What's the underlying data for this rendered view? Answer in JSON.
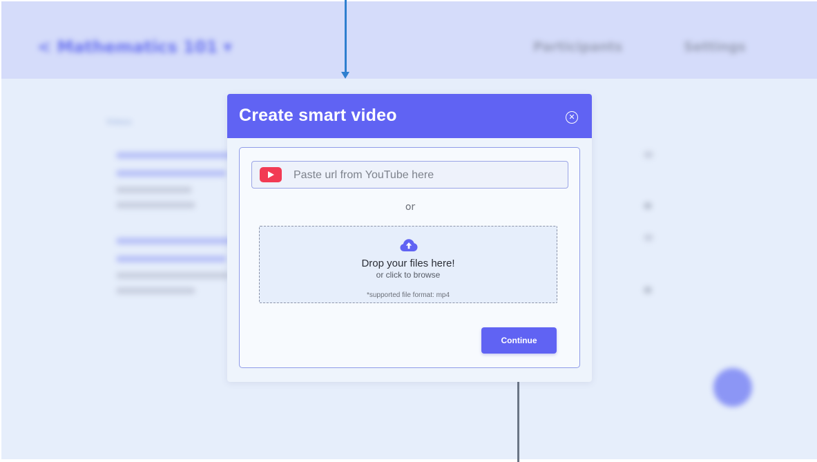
{
  "background": {
    "course_title": "< Mathematics 101 ▾",
    "nav": [
      "Participants",
      "Settings"
    ],
    "section_label": "Videos"
  },
  "modal": {
    "title": "Create smart video",
    "close_icon": "close-circle-icon",
    "url_placeholder": "Paste url from YouTube here",
    "youtube_icon": "youtube-icon",
    "or_label": "or",
    "dropzone": {
      "icon": "cloud-upload-icon",
      "title": "Drop your files here!",
      "subtitle": "or click to browse",
      "format_note": "*supported file format: mp4"
    },
    "continue_label": "Continue"
  },
  "colors": {
    "accent": "#6063f3",
    "youtube": "#f23b54",
    "annotation_arrow_top": "#2f7fcf",
    "annotation_arrow_bottom": "#6a7585"
  }
}
